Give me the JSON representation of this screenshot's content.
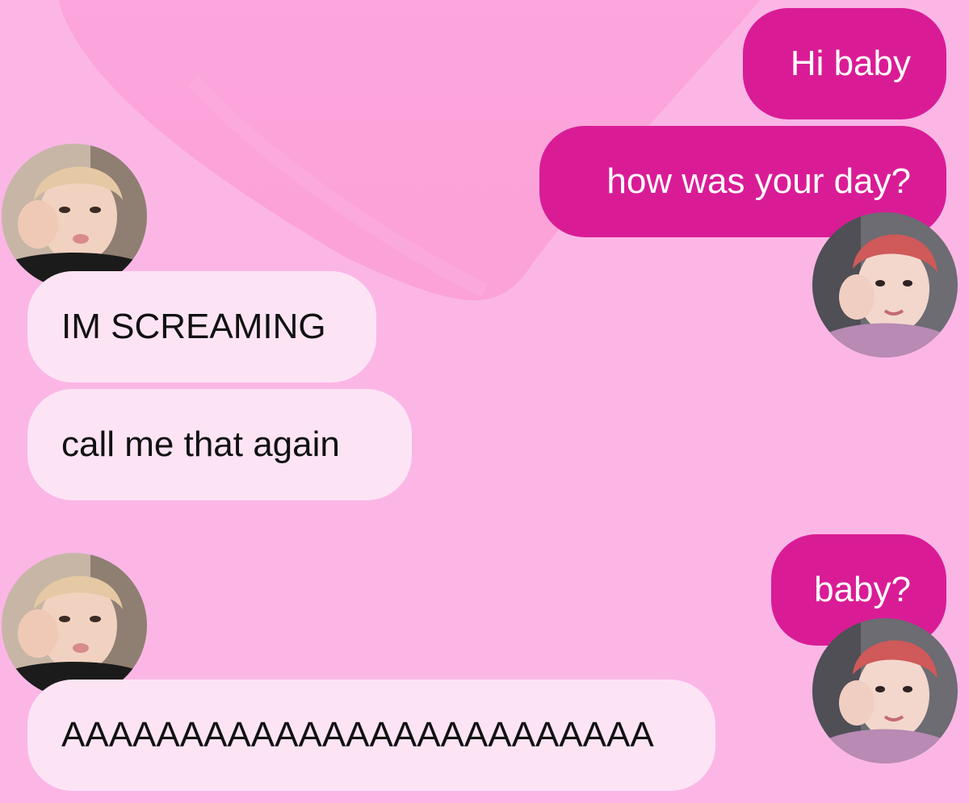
{
  "theme": {
    "background": "#fbb6e6",
    "outgoing_bubble": "#d91c96",
    "incoming_bubble": "#fde4f5",
    "outgoing_text": "#ffffff",
    "incoming_text": "#111111"
  },
  "messages": [
    {
      "direction": "outgoing",
      "text": "Hi baby"
    },
    {
      "direction": "outgoing",
      "text": "how was your day?"
    },
    {
      "direction": "incoming",
      "text": "IM SCREAMING"
    },
    {
      "direction": "incoming",
      "text": "call me that again"
    },
    {
      "direction": "outgoing",
      "text": "baby?"
    },
    {
      "direction": "incoming",
      "text": "AAAAAAAAAAAAAAAAAAAAAAAAA"
    }
  ],
  "avatars": {
    "incoming": {
      "icon": "blonde-hair-person-avatar"
    },
    "outgoing": {
      "icon": "red-hair-person-avatar"
    }
  }
}
